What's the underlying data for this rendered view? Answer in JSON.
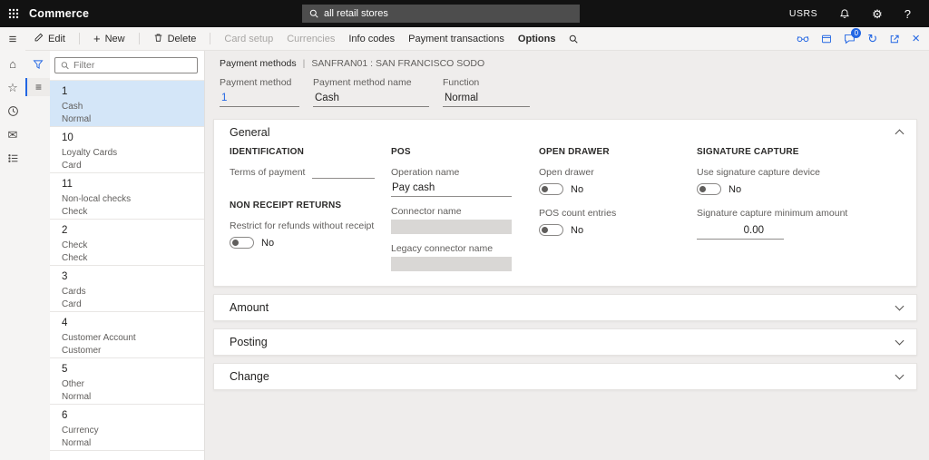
{
  "icons": {
    "hamburger": "≡",
    "home": "⌂",
    "star": "☆",
    "mail": "✉",
    "gear": "⚙",
    "question": "?",
    "plus": "+",
    "refresh": "↻",
    "close": "×",
    "list_view": "≡"
  },
  "colors": {
    "accent": "#2266e3",
    "topbar_bg": "#121212",
    "selected_item_bg": "#d4e6f8"
  },
  "topbar": {
    "app": "Commerce",
    "search_value": "all retail stores",
    "user": "USRS"
  },
  "actionbar": {
    "edit": "Edit",
    "new": "New",
    "delete": "Delete",
    "card_setup": "Card setup",
    "currencies": "Currencies",
    "info_codes": "Info codes",
    "payment_transactions": "Payment transactions",
    "options": "Options",
    "chat_badge": "0"
  },
  "list": {
    "filter_placeholder": "Filter",
    "items": [
      {
        "id": "1",
        "name": "Cash",
        "fn": "Normal"
      },
      {
        "id": "10",
        "name": "Loyalty Cards",
        "fn": "Card"
      },
      {
        "id": "11",
        "name": "Non-local checks",
        "fn": "Check"
      },
      {
        "id": "2",
        "name": "Check",
        "fn": "Check"
      },
      {
        "id": "3",
        "name": "Cards",
        "fn": "Card"
      },
      {
        "id": "4",
        "name": "Customer Account",
        "fn": "Customer"
      },
      {
        "id": "5",
        "name": "Other",
        "fn": "Normal"
      },
      {
        "id": "6",
        "name": "Currency",
        "fn": "Normal"
      }
    ]
  },
  "main": {
    "crumb_title": "Payment methods",
    "crumb_sep": "|",
    "crumb_sub": "SANFRAN01 : SAN FRANCISCO SODO",
    "fields": [
      {
        "label": "Payment method",
        "value": "1"
      },
      {
        "label": "Payment method name",
        "value": "Cash"
      },
      {
        "label": "Function",
        "value": "Normal"
      }
    ],
    "general": {
      "title": "General",
      "identification_heading": "IDENTIFICATION",
      "terms_label": "Terms of payment",
      "non_receipt_heading": "NON RECEIPT RETURNS",
      "restrict_label": "Restrict for refunds without receipt",
      "restrict_value": "No",
      "pos_heading": "POS",
      "operation_label": "Operation name",
      "operation_value": "Pay cash",
      "connector_label": "Connector name",
      "legacy_label": "Legacy connector name",
      "drawer_heading": "OPEN DRAWER",
      "drawer_label": "Open drawer",
      "drawer_value": "No",
      "count_label": "POS count entries",
      "count_value": "No",
      "signature_heading": "SIGNATURE CAPTURE",
      "device_label": "Use signature capture device",
      "device_value": "No",
      "amount_label": "Signature capture minimum amount",
      "amount_value": "0.00"
    },
    "sections": [
      {
        "title": "Amount"
      },
      {
        "title": "Posting"
      },
      {
        "title": "Change"
      }
    ]
  }
}
